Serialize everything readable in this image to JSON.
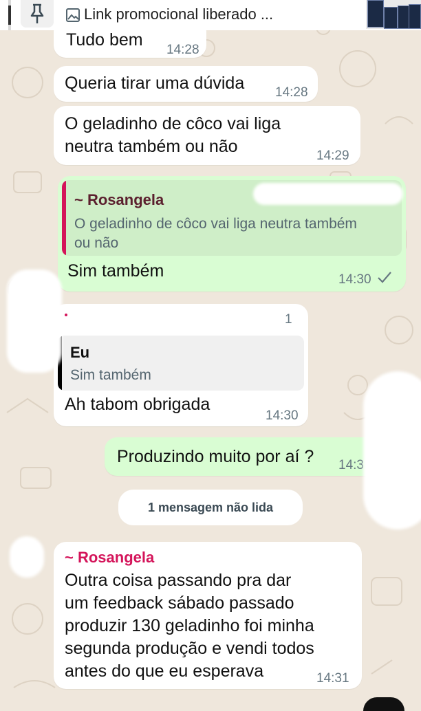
{
  "pinned": {
    "text": "Link promocional liberado ..."
  },
  "messages": [
    {
      "id": "m0",
      "text": "Tudo bem",
      "time": "14:28"
    },
    {
      "id": "m1",
      "text": "Queria tirar uma dúvida",
      "time": "14:28"
    },
    {
      "id": "m2",
      "text": "O geladinho de côco vai liga\nneutra também ou não",
      "time": "14:29"
    },
    {
      "id": "m3",
      "quote_author": "~ Rosangela",
      "quote_text": "O geladinho de côco vai liga neutra também\nou não",
      "text": "Sim também",
      "time": "14:30"
    },
    {
      "id": "m4",
      "badge": "1",
      "quote_author": "Eu",
      "quote_text": "Sim também",
      "text": "Ah tabom obrigada",
      "time": "14:30"
    },
    {
      "id": "m5",
      "text": "Produzindo muito por aí ?",
      "time": "14:3"
    },
    {
      "id": "m6",
      "sender": "~ Rosangela",
      "text": "Outra coisa passando pra dar\num feedback sábado passado\nproduzir 130 geladinho foi minha\nsegunda produção e vendi todos\nantes do que eu esperava",
      "time": "14:31"
    }
  ],
  "unread_divider": "1 mensagem não lida",
  "colors": {
    "incoming": "#ffffff",
    "outgoing": "#d9fdd3",
    "rosangela": "#d4145a",
    "eu_quote_bar": "#000000"
  },
  "icons": [
    "pin-icon",
    "image-icon",
    "read-check-icon"
  ]
}
